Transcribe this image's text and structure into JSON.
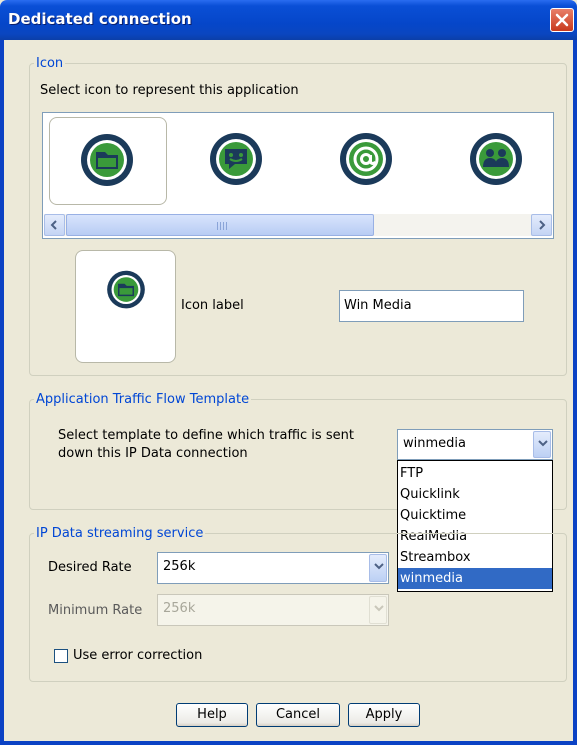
{
  "window": {
    "title": "Dedicated connection",
    "close_icon": "close-icon"
  },
  "icon_group": {
    "legend": "Icon",
    "instruction": "Select icon to represent this application",
    "icons": [
      {
        "name": "folder-icon",
        "color": "#3a9a3a",
        "selected": true
      },
      {
        "name": "chat-icon",
        "color": "#3a9a3a",
        "selected": false
      },
      {
        "name": "at-sign-icon",
        "color": "#3a9a3a",
        "selected": false
      },
      {
        "name": "users-icon",
        "color": "#3a9a3a",
        "selected": false
      }
    ],
    "preview_icon": "folder-icon",
    "icon_label": "Icon label",
    "icon_label_value": "Win Media"
  },
  "traffic_group": {
    "legend": "Application Traffic Flow Template",
    "instruction_line1": "Select template to define which traffic is sent",
    "instruction_line2": "down this IP Data connection",
    "selected": "winmedia",
    "options": [
      "FTP",
      "Quicklink",
      "Quicktime",
      "RealMedia",
      "Streambox",
      "winmedia"
    ]
  },
  "streaming_group": {
    "legend": "IP Data streaming service",
    "desired_rate_label": "Desired Rate",
    "desired_rate_value": "256k",
    "minimum_rate_label": "Minimum Rate",
    "minimum_rate_value": "256k",
    "error_correction_label": "Use error correction",
    "error_correction_checked": false
  },
  "buttons": {
    "help": "Help",
    "cancel": "Cancel",
    "apply": "Apply"
  },
  "colors": {
    "titlebar": "#0a4fd6",
    "legend": "#0046d5",
    "selection": "#316ac5",
    "icon_ring": "#1b3a5a",
    "icon_fill": "#3a9a3a"
  }
}
